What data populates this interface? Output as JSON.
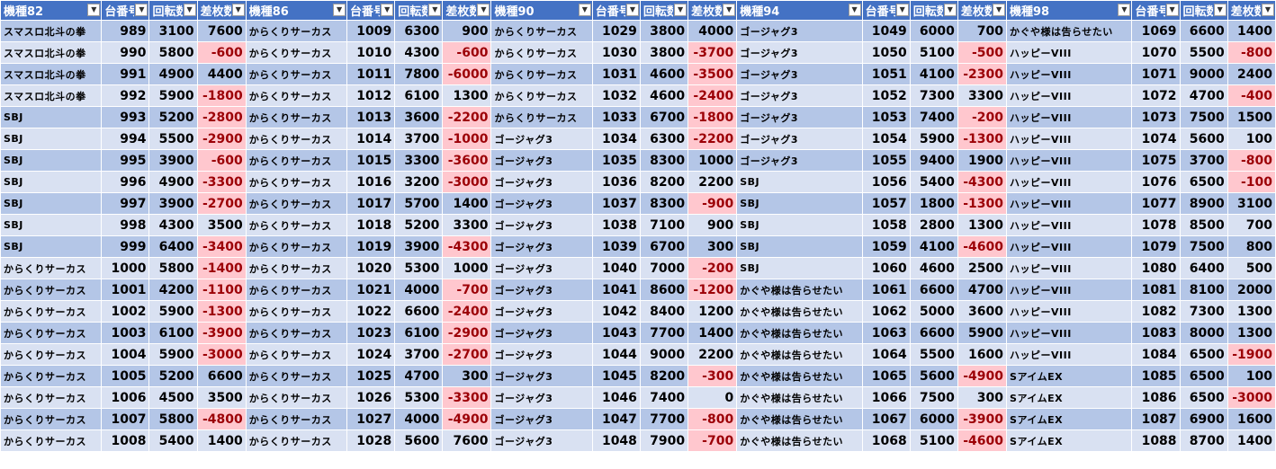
{
  "filter_icon": "dropdown-arrow-icon",
  "colors": {
    "header_bg": "#4472c4",
    "band_dark": "#b4c6e7",
    "band_light": "#d9e1f2",
    "negative_bg": "#ffc7ce",
    "negative_text": "#9c0006"
  },
  "groups": [
    {
      "headers": [
        "機種82",
        "台番号",
        "回転数",
        "差枚数"
      ],
      "rows": [
        [
          "スマスロ北斗の拳",
          "989",
          "3100",
          "7600"
        ],
        [
          "スマスロ北斗の拳",
          "990",
          "5800",
          "-600"
        ],
        [
          "スマスロ北斗の拳",
          "991",
          "4900",
          "4400"
        ],
        [
          "スマスロ北斗の拳",
          "992",
          "5900",
          "-1800"
        ],
        [
          "SBJ",
          "993",
          "5200",
          "-2800"
        ],
        [
          "SBJ",
          "994",
          "5500",
          "-2900"
        ],
        [
          "SBJ",
          "995",
          "3900",
          "-600"
        ],
        [
          "SBJ",
          "996",
          "4900",
          "-3300"
        ],
        [
          "SBJ",
          "997",
          "3900",
          "-2700"
        ],
        [
          "SBJ",
          "998",
          "4300",
          "3500"
        ],
        [
          "SBJ",
          "999",
          "6400",
          "-3400"
        ],
        [
          "からくりサーカス",
          "1000",
          "5800",
          "-1400"
        ],
        [
          "からくりサーカス",
          "1001",
          "4200",
          "-1100"
        ],
        [
          "からくりサーカス",
          "1002",
          "5900",
          "-1300"
        ],
        [
          "からくりサーカス",
          "1003",
          "6100",
          "-3900"
        ],
        [
          "からくりサーカス",
          "1004",
          "5900",
          "-3000"
        ],
        [
          "からくりサーカス",
          "1005",
          "5200",
          "6600"
        ],
        [
          "からくりサーカス",
          "1006",
          "4500",
          "3500"
        ],
        [
          "からくりサーカス",
          "1007",
          "5800",
          "-4800"
        ],
        [
          "からくりサーカス",
          "1008",
          "5400",
          "1400"
        ]
      ]
    },
    {
      "headers": [
        "機種86",
        "台番号",
        "回転数",
        "差枚数"
      ],
      "rows": [
        [
          "からくりサーカス",
          "1009",
          "6300",
          "900"
        ],
        [
          "からくりサーカス",
          "1010",
          "4300",
          "-600"
        ],
        [
          "からくりサーカス",
          "1011",
          "7800",
          "-6000"
        ],
        [
          "からくりサーカス",
          "1012",
          "6100",
          "1300"
        ],
        [
          "からくりサーカス",
          "1013",
          "3600",
          "-2200"
        ],
        [
          "からくりサーカス",
          "1014",
          "3700",
          "-1000"
        ],
        [
          "からくりサーカス",
          "1015",
          "3300",
          "-3600"
        ],
        [
          "からくりサーカス",
          "1016",
          "3200",
          "-3000"
        ],
        [
          "からくりサーカス",
          "1017",
          "5700",
          "1400"
        ],
        [
          "からくりサーカス",
          "1018",
          "5200",
          "3300"
        ],
        [
          "からくりサーカス",
          "1019",
          "3900",
          "-4300"
        ],
        [
          "からくりサーカス",
          "1020",
          "5300",
          "1000"
        ],
        [
          "からくりサーカス",
          "1021",
          "4000",
          "-700"
        ],
        [
          "からくりサーカス",
          "1022",
          "6600",
          "-2400"
        ],
        [
          "からくりサーカス",
          "1023",
          "6100",
          "-2900"
        ],
        [
          "からくりサーカス",
          "1024",
          "3700",
          "-2700"
        ],
        [
          "からくりサーカス",
          "1025",
          "4700",
          "300"
        ],
        [
          "からくりサーカス",
          "1026",
          "5300",
          "-3300"
        ],
        [
          "からくりサーカス",
          "1027",
          "4000",
          "-4900"
        ],
        [
          "からくりサーカス",
          "1028",
          "5600",
          "7600"
        ]
      ]
    },
    {
      "headers": [
        "機種90",
        "台番号",
        "回転数",
        "差枚数"
      ],
      "rows": [
        [
          "からくりサーカス",
          "1029",
          "3800",
          "4000"
        ],
        [
          "からくりサーカス",
          "1030",
          "3800",
          "-3700"
        ],
        [
          "からくりサーカス",
          "1031",
          "4600",
          "-3500"
        ],
        [
          "からくりサーカス",
          "1032",
          "4600",
          "-2400"
        ],
        [
          "からくりサーカス",
          "1033",
          "6700",
          "-1800"
        ],
        [
          "ゴージャグ3",
          "1034",
          "6300",
          "-2200"
        ],
        [
          "ゴージャグ3",
          "1035",
          "8300",
          "1000"
        ],
        [
          "ゴージャグ3",
          "1036",
          "8200",
          "2200"
        ],
        [
          "ゴージャグ3",
          "1037",
          "8300",
          "-900"
        ],
        [
          "ゴージャグ3",
          "1038",
          "7100",
          "900"
        ],
        [
          "ゴージャグ3",
          "1039",
          "6700",
          "300"
        ],
        [
          "ゴージャグ3",
          "1040",
          "7000",
          "-200"
        ],
        [
          "ゴージャグ3",
          "1041",
          "8600",
          "-1200"
        ],
        [
          "ゴージャグ3",
          "1042",
          "8400",
          "1200"
        ],
        [
          "ゴージャグ3",
          "1043",
          "7700",
          "1400"
        ],
        [
          "ゴージャグ3",
          "1044",
          "9000",
          "2200"
        ],
        [
          "ゴージャグ3",
          "1045",
          "8200",
          "-300"
        ],
        [
          "ゴージャグ3",
          "1046",
          "7400",
          "0"
        ],
        [
          "ゴージャグ3",
          "1047",
          "7700",
          "-800"
        ],
        [
          "ゴージャグ3",
          "1048",
          "7900",
          "-700"
        ]
      ]
    },
    {
      "headers": [
        "機種94",
        "台番号",
        "回転数",
        "差枚数"
      ],
      "rows": [
        [
          "ゴージャグ3",
          "1049",
          "6000",
          "700"
        ],
        [
          "ゴージャグ3",
          "1050",
          "5100",
          "-500"
        ],
        [
          "ゴージャグ3",
          "1051",
          "4100",
          "-2300"
        ],
        [
          "ゴージャグ3",
          "1052",
          "7300",
          "3300"
        ],
        [
          "ゴージャグ3",
          "1053",
          "7400",
          "-200"
        ],
        [
          "ゴージャグ3",
          "1054",
          "5900",
          "-1300"
        ],
        [
          "ゴージャグ3",
          "1055",
          "9400",
          "1900"
        ],
        [
          "SBJ",
          "1056",
          "5400",
          "-4300"
        ],
        [
          "SBJ",
          "1057",
          "1800",
          "-1300"
        ],
        [
          "SBJ",
          "1058",
          "2800",
          "1300"
        ],
        [
          "SBJ",
          "1059",
          "4100",
          "-4600"
        ],
        [
          "SBJ",
          "1060",
          "4600",
          "2500"
        ],
        [
          "かぐや様は告らせたい",
          "1061",
          "6600",
          "4700"
        ],
        [
          "かぐや様は告らせたい",
          "1062",
          "5000",
          "3600"
        ],
        [
          "かぐや様は告らせたい",
          "1063",
          "6600",
          "5900"
        ],
        [
          "かぐや様は告らせたい",
          "1064",
          "5500",
          "1600"
        ],
        [
          "かぐや様は告らせたい",
          "1065",
          "5600",
          "-4900"
        ],
        [
          "かぐや様は告らせたい",
          "1066",
          "7500",
          "300"
        ],
        [
          "かぐや様は告らせたい",
          "1067",
          "6000",
          "-3900"
        ],
        [
          "かぐや様は告らせたい",
          "1068",
          "5100",
          "-4600"
        ]
      ]
    },
    {
      "headers": [
        "機種98",
        "台番号",
        "回転数",
        "差枚数"
      ],
      "rows": [
        [
          "かぐや様は告らせたい",
          "1069",
          "6600",
          "1400"
        ],
        [
          "ハッピーVIII",
          "1070",
          "5500",
          "-800"
        ],
        [
          "ハッピーVIII",
          "1071",
          "9000",
          "2400"
        ],
        [
          "ハッピーVIII",
          "1072",
          "4700",
          "-400"
        ],
        [
          "ハッピーVIII",
          "1073",
          "7500",
          "1500"
        ],
        [
          "ハッピーVIII",
          "1074",
          "5600",
          "100"
        ],
        [
          "ハッピーVIII",
          "1075",
          "3700",
          "-800"
        ],
        [
          "ハッピーVIII",
          "1076",
          "6500",
          "-100"
        ],
        [
          "ハッピーVIII",
          "1077",
          "8900",
          "3100"
        ],
        [
          "ハッピーVIII",
          "1078",
          "8500",
          "700"
        ],
        [
          "ハッピーVIII",
          "1079",
          "7500",
          "800"
        ],
        [
          "ハッピーVIII",
          "1080",
          "6400",
          "500"
        ],
        [
          "ハッピーVIII",
          "1081",
          "8100",
          "2000"
        ],
        [
          "ハッピーVIII",
          "1082",
          "7300",
          "1300"
        ],
        [
          "ハッピーVIII",
          "1083",
          "8000",
          "1300"
        ],
        [
          "ハッピーVIII",
          "1084",
          "6500",
          "-1900"
        ],
        [
          "SアイムEX",
          "1085",
          "6500",
          "100"
        ],
        [
          "SアイムEX",
          "1086",
          "6500",
          "-3000"
        ],
        [
          "SアイムEX",
          "1087",
          "6900",
          "1600"
        ],
        [
          "SアイムEX",
          "1088",
          "8700",
          "1400"
        ]
      ]
    }
  ]
}
